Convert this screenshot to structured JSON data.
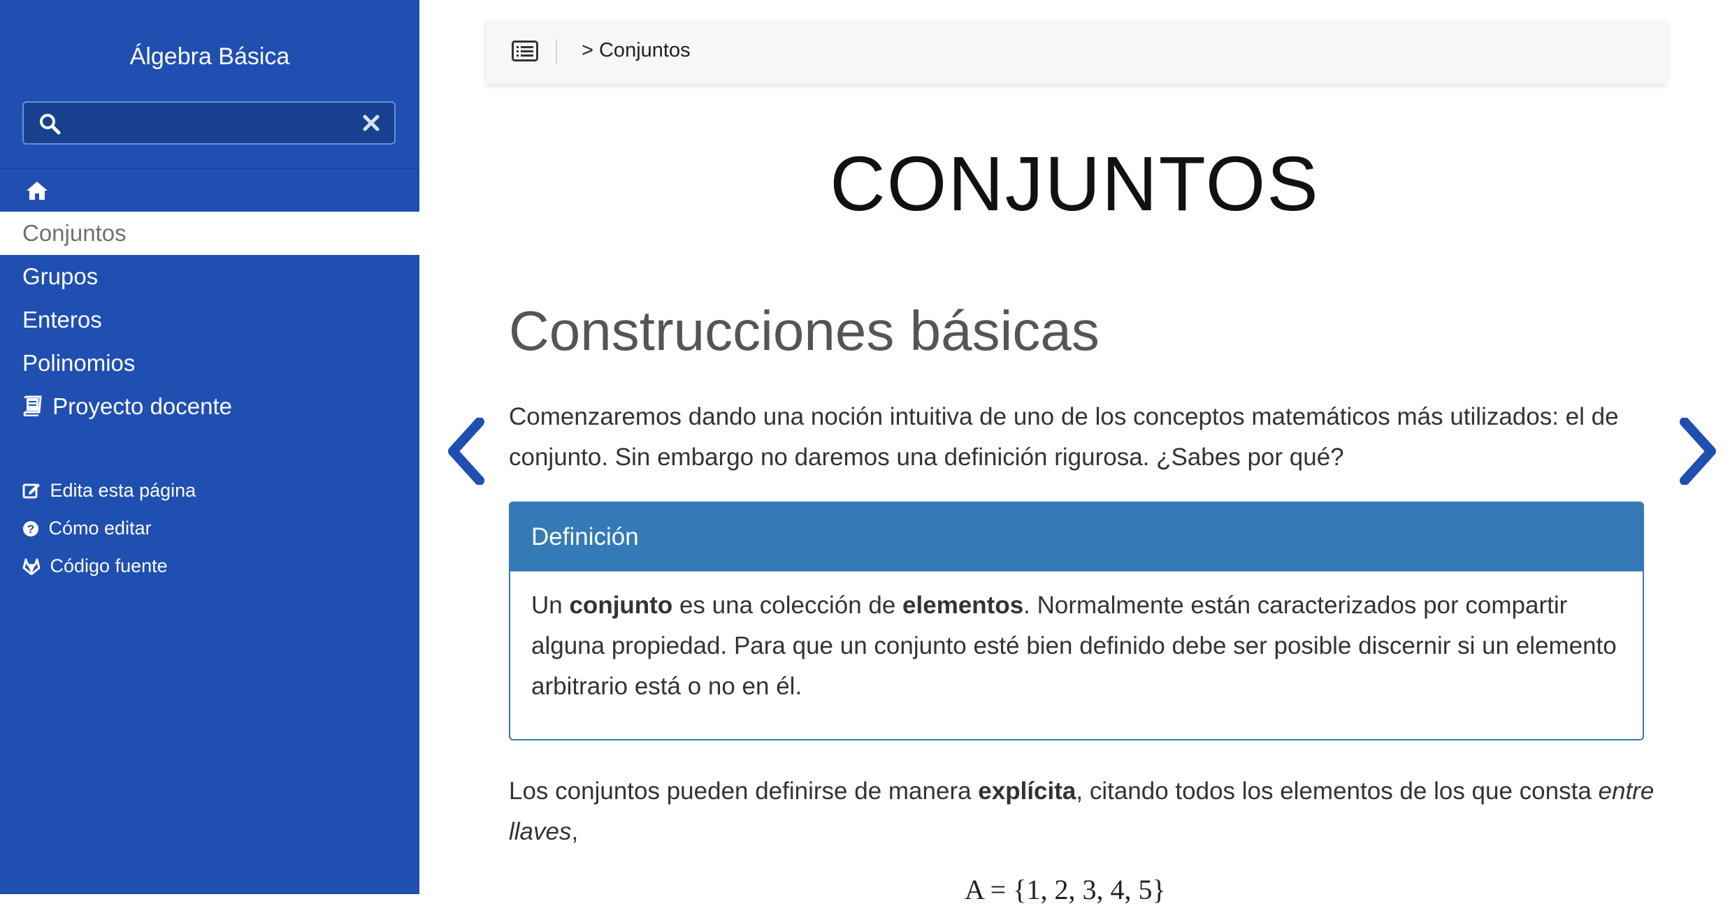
{
  "sidebar": {
    "title": "Álgebra Básica",
    "search": {
      "value": "",
      "placeholder": ""
    },
    "items": [
      {
        "label": "Conjuntos",
        "active": true
      },
      {
        "label": "Grupos"
      },
      {
        "label": "Enteros"
      },
      {
        "label": "Polinomios"
      },
      {
        "label": "Proyecto docente",
        "icon": "book-icon"
      }
    ],
    "links": [
      {
        "label": "Edita esta página",
        "icon": "edit-icon"
      },
      {
        "label": "Cómo editar",
        "icon": "question-circle-icon"
      },
      {
        "label": "Código fuente",
        "icon": "gitlab-icon"
      }
    ],
    "colors": {
      "background": "#1f4fb1",
      "active_bg": "#ffffff",
      "active_text": "#6f6f6f"
    }
  },
  "topbar": {
    "breadcrumb": "> Conjuntos"
  },
  "main": {
    "title": "CONJUNTOS",
    "section_heading": "Construcciones básicas",
    "intro": "Comenzaremos dando una noción intuitiva de uno de los conceptos matemáticos más utilizados: el de conjunto. Sin embargo no daremos una definición rigurosa. ¿Sabes por qué?",
    "definition": {
      "header": "Definición",
      "part1": "Un ",
      "term1": "conjunto",
      "part2": " es una colección de ",
      "term2": "elementos",
      "part3": ". Normalmente están caracterizados por compartir alguna propiedad. Para que un conjunto esté bien definido debe ser posible discernir si un elemento arbitrario está o no en él."
    },
    "explicit": {
      "part1": "Los conjuntos pueden definirse de manera ",
      "term": "explícita",
      "part2": ", citando todos los elementos de los que consta ",
      "italic": "entre llaves",
      "part3": ","
    },
    "math": "A = {1, 2, 3, 4, 5}",
    "colors": {
      "accent": "#337ab7",
      "nav_arrow": "#1f4fb1"
    }
  }
}
